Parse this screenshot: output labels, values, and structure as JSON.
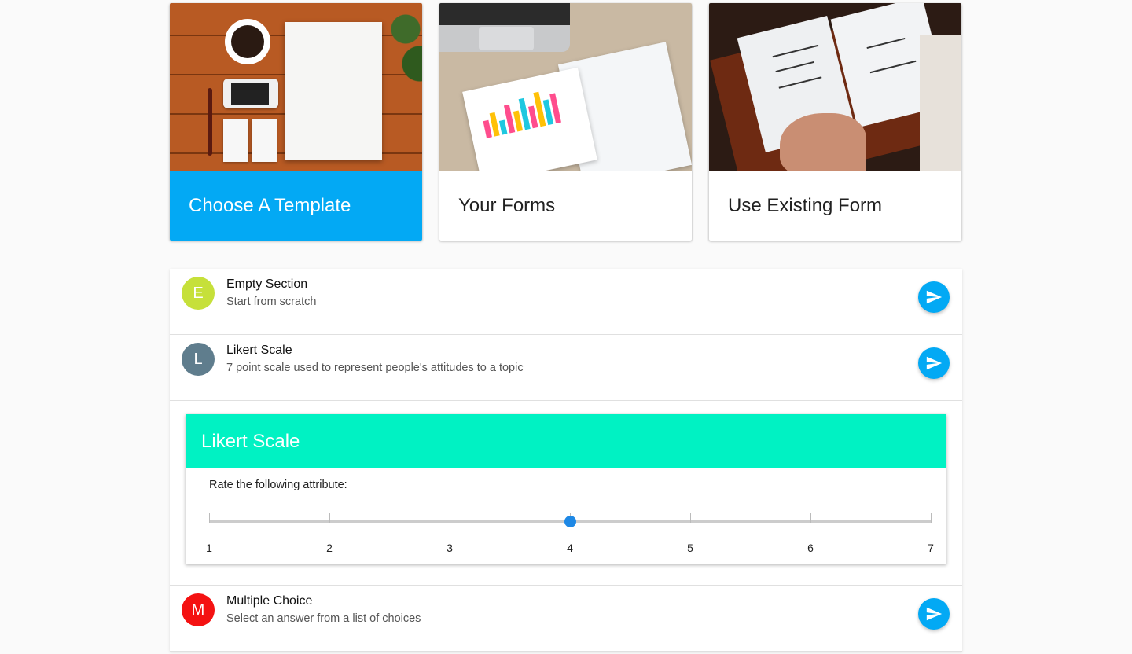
{
  "cards": [
    {
      "label": "Choose A Template",
      "image": "desk flat-lay photo"
    },
    {
      "label": "Your Forms",
      "image": "analytics charts photo"
    },
    {
      "label": "Use Existing Form",
      "image": "notebook handwriting photo"
    }
  ],
  "colors": {
    "accent": "#03a9f4",
    "likert_header": "#00f2c3",
    "slider_thumb": "#1e88e5"
  },
  "sections": [
    {
      "avatar_letter": "E",
      "avatar_color": "#c6e03a",
      "title": "Empty Section",
      "subtitle": "Start from scratch",
      "action_icon": "send-icon"
    },
    {
      "avatar_letter": "L",
      "avatar_color": "#5f7d8d",
      "title": "Likert Scale",
      "subtitle": "7 point scale used to represent people's attitudes to a topic",
      "action_icon": "send-icon"
    }
  ],
  "likert_preview": {
    "title": "Likert Scale",
    "prompt": "Rate the following attribute:",
    "scale": [
      "1",
      "2",
      "3",
      "4",
      "5",
      "6",
      "7"
    ],
    "selected": "4"
  },
  "sections_after": [
    {
      "avatar_letter": "M",
      "avatar_color": "#f41212",
      "title": "Multiple Choice",
      "subtitle": "Select an answer from a list of choices",
      "action_icon": "send-icon"
    }
  ]
}
